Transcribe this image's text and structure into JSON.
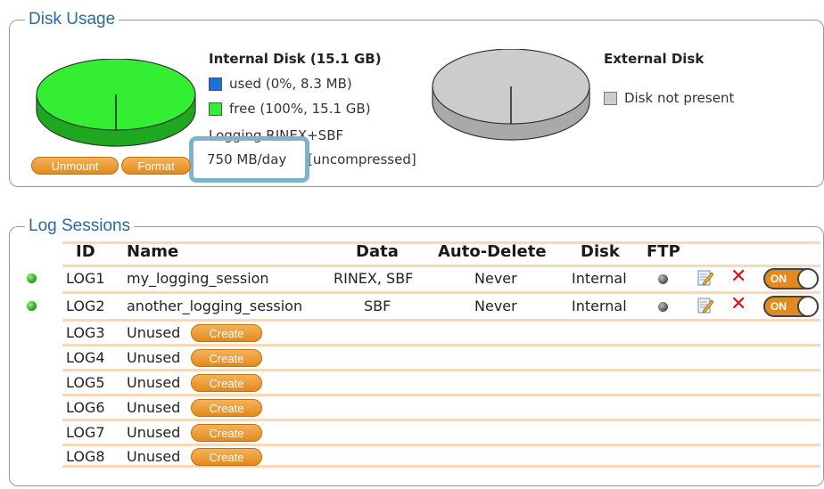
{
  "disk_usage": {
    "title": "Disk Usage",
    "internal": {
      "title": "Internal Disk (15.1 GB)",
      "used_label": "used (0%, 8.3 MB)",
      "free_label": "free (100%, 15.1 GB)",
      "used_fraction": 0.0,
      "used_color": "#1f6fd8",
      "free_color": "#33ee33",
      "logging_line1": "Logging RINEX+SBF",
      "logging_rate": "750 MB/day",
      "logging_note": "[uncompressed]",
      "unmount_label": "Unmount",
      "format_label": "Format"
    },
    "external": {
      "title": "External Disk",
      "status_label": "Disk not present",
      "color": "#cccccc"
    }
  },
  "log_sessions": {
    "title": "Log Sessions",
    "headers": {
      "id": "ID",
      "name": "Name",
      "data": "Data",
      "auto_delete": "Auto-Delete",
      "disk": "Disk",
      "ftp": "FTP"
    },
    "active_rows": [
      {
        "id": "LOG1",
        "name": "my_logging_session",
        "data": "RINEX, SBF",
        "auto_delete": "Never",
        "disk": "Internal",
        "toggle": "ON"
      },
      {
        "id": "LOG2",
        "name": "another_logging_session",
        "data": "SBF",
        "auto_delete": "Never",
        "disk": "Internal",
        "toggle": "ON"
      }
    ],
    "unused_rows": [
      {
        "id": "LOG3",
        "status": "Unused",
        "button": "Create"
      },
      {
        "id": "LOG4",
        "status": "Unused",
        "button": "Create"
      },
      {
        "id": "LOG5",
        "status": "Unused",
        "button": "Create"
      },
      {
        "id": "LOG6",
        "status": "Unused",
        "button": "Create"
      },
      {
        "id": "LOG7",
        "status": "Unused",
        "button": "Create"
      },
      {
        "id": "LOG8",
        "status": "Unused",
        "button": "Create"
      }
    ]
  }
}
